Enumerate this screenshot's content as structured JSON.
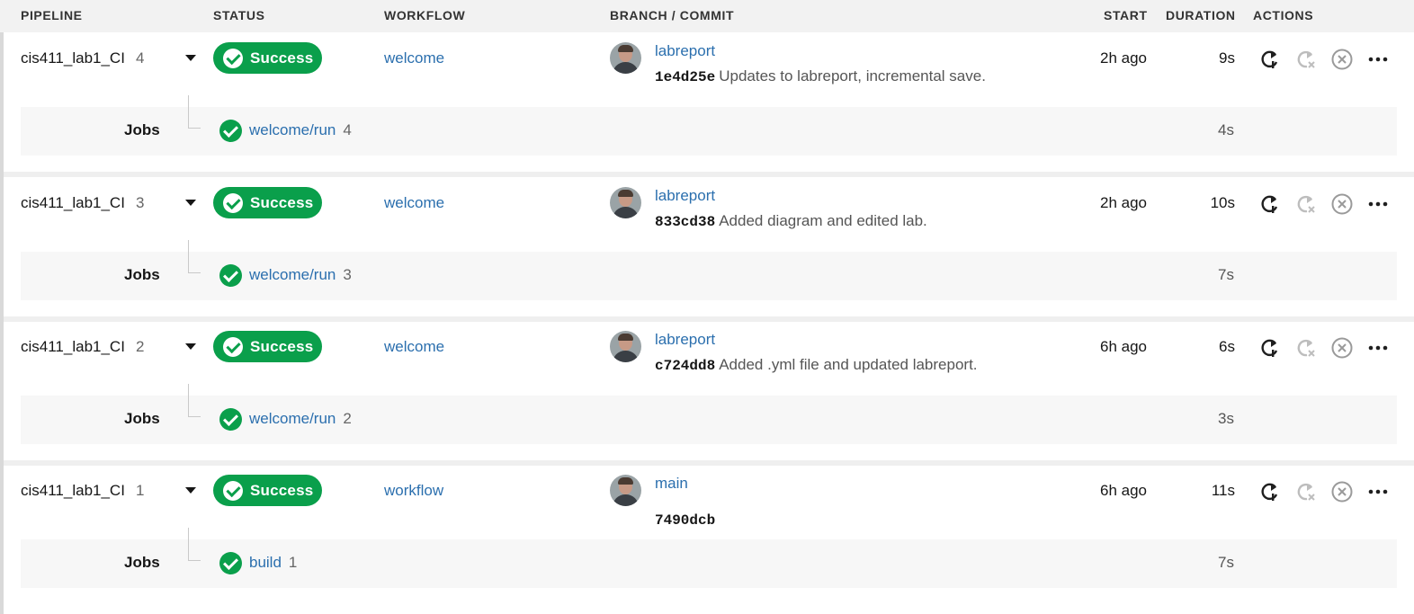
{
  "colors": {
    "success": "#0a9f4b",
    "link": "#2b6fae",
    "header_bg": "#f2f2f2",
    "jobs_bg": "#f7f7f7"
  },
  "header": {
    "pipeline": "PIPELINE",
    "status": "STATUS",
    "workflow": "WORKFLOW",
    "branch_commit": "BRANCH / COMMIT",
    "start": "START",
    "duration": "DURATION",
    "actions": "ACTIONS"
  },
  "pipelines": [
    {
      "name": "cis411_lab1_CI",
      "number": "4",
      "status": "Success",
      "workflow": "welcome",
      "branch": "labreport",
      "commit_sha": "1e4d25e",
      "commit_msg": "Updates to labreport, incremental save.",
      "start": "2h ago",
      "duration": "9s",
      "jobs_label": "Jobs",
      "job": {
        "name": "welcome/run",
        "number": "4",
        "duration": "4s"
      }
    },
    {
      "name": "cis411_lab1_CI",
      "number": "3",
      "status": "Success",
      "workflow": "welcome",
      "branch": "labreport",
      "commit_sha": "833cd38",
      "commit_msg": "Added diagram and edited lab.",
      "start": "2h ago",
      "duration": "10s",
      "jobs_label": "Jobs",
      "job": {
        "name": "welcome/run",
        "number": "3",
        "duration": "7s"
      }
    },
    {
      "name": "cis411_lab1_CI",
      "number": "2",
      "status": "Success",
      "workflow": "welcome",
      "branch": "labreport",
      "commit_sha": "c724dd8",
      "commit_msg": "Added .yml file and updated labreport.",
      "start": "6h ago",
      "duration": "6s",
      "jobs_label": "Jobs",
      "job": {
        "name": "welcome/run",
        "number": "2",
        "duration": "3s"
      }
    },
    {
      "name": "cis411_lab1_CI",
      "number": "1",
      "status": "Success",
      "workflow": "workflow",
      "branch": "main",
      "commit_sha": "7490dcb",
      "commit_msg": "",
      "start": "6h ago",
      "duration": "11s",
      "jobs_label": "Jobs",
      "job": {
        "name": "build",
        "number": "1",
        "duration": "7s"
      }
    }
  ],
  "action_icons": [
    "rerun-icon",
    "rerun-failed-icon",
    "cancel-icon",
    "more-icon"
  ]
}
